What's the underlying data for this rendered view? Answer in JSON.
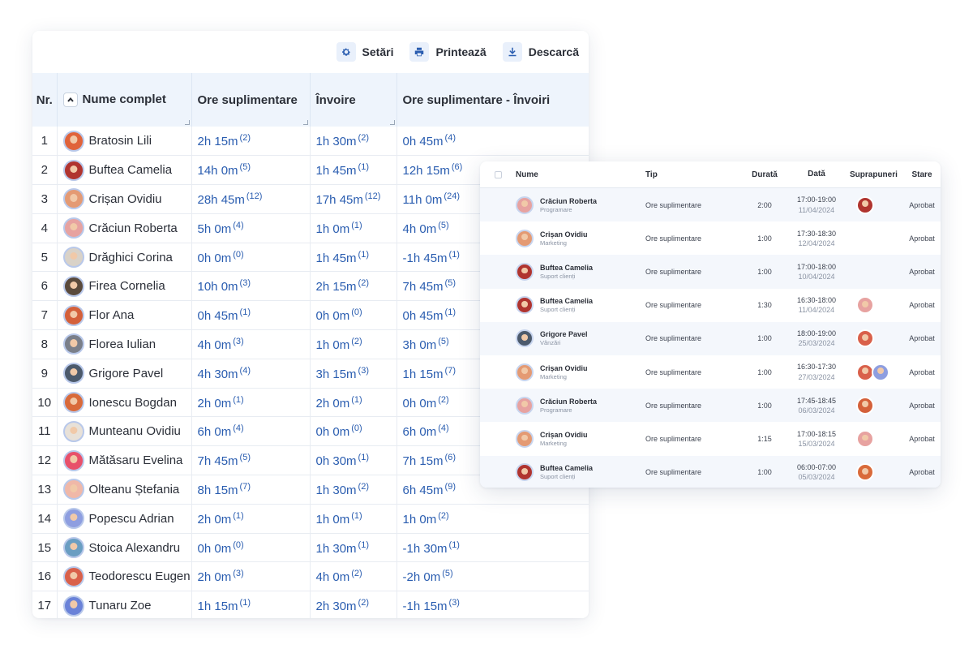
{
  "toolbar": {
    "settings_label": "Setări",
    "print_label": "Printează",
    "download_label": "Descarcă",
    "accent_color": "#2a5db0"
  },
  "main_table": {
    "headers": {
      "nr": "Nr.",
      "name": "Nume complet",
      "overtime": "Ore suplimentare",
      "leave": "Învoire",
      "diff": "Ore suplimentare - Învoiri"
    },
    "rows": [
      {
        "nr": "1",
        "name": "Bratosin Lili",
        "ov": "2h 15m",
        "ov_c": "(2)",
        "lv": "1h 30m",
        "lv_c": "(2)",
        "df": "0h 45m",
        "df_c": "(4)",
        "avatar_color": "#e0633a"
      },
      {
        "nr": "2",
        "name": "Buftea Camelia",
        "ov": "14h 0m",
        "ov_c": "(5)",
        "lv": "1h 45m",
        "lv_c": "(1)",
        "df": "12h 15m",
        "df_c": "(6)",
        "avatar_color": "#b0342f"
      },
      {
        "nr": "3",
        "name": "Crișan Ovidiu",
        "ov": "28h 45m",
        "ov_c": "(12)",
        "lv": "17h 45m",
        "lv_c": "(12)",
        "df": "11h 0m",
        "df_c": "(24)",
        "avatar_color": "#e49a73"
      },
      {
        "nr": "4",
        "name": "Crăciun Roberta",
        "ov": "5h 0m",
        "ov_c": "(4)",
        "lv": "1h 0m",
        "lv_c": "(1)",
        "df": "4h 0m",
        "df_c": "(5)",
        "avatar_color": "#e7a2a0"
      },
      {
        "nr": "5",
        "name": "Drăghici Corina",
        "ov": "0h 0m",
        "ov_c": "(0)",
        "lv": "1h 45m",
        "lv_c": "(1)",
        "df": "-1h 45m",
        "df_c": "(1)",
        "avatar_color": "#d9d2c8"
      },
      {
        "nr": "6",
        "name": "Firea Cornelia",
        "ov": "10h 0m",
        "ov_c": "(3)",
        "lv": "2h 15m",
        "lv_c": "(2)",
        "df": "7h 45m",
        "df_c": "(5)",
        "avatar_color": "#5a4a3c"
      },
      {
        "nr": "7",
        "name": "Flor Ana",
        "ov": "0h 45m",
        "ov_c": "(1)",
        "lv": "0h 0m",
        "lv_c": "(0)",
        "df": "0h 45m",
        "df_c": "(1)",
        "avatar_color": "#d4603a"
      },
      {
        "nr": "8",
        "name": "Florea Iulian",
        "ov": "4h 0m",
        "ov_c": "(3)",
        "lv": "1h 0m",
        "lv_c": "(2)",
        "df": "3h 0m",
        "df_c": "(5)",
        "avatar_color": "#7a7f8a"
      },
      {
        "nr": "9",
        "name": "Grigore Pavel",
        "ov": "4h 30m",
        "ov_c": "(4)",
        "lv": "3h 15m",
        "lv_c": "(3)",
        "df": "1h 15m",
        "df_c": "(7)",
        "avatar_color": "#4c5a6c"
      },
      {
        "nr": "10",
        "name": "Ionescu Bogdan",
        "ov": "2h 0m",
        "ov_c": "(1)",
        "lv": "2h 0m",
        "lv_c": "(1)",
        "df": "0h 0m",
        "df_c": "(2)",
        "avatar_color": "#d96a3a"
      },
      {
        "nr": "11",
        "name": "Munteanu Ovidiu",
        "ov": "6h 0m",
        "ov_c": "(4)",
        "lv": "0h 0m",
        "lv_c": "(0)",
        "df": "6h 0m",
        "df_c": "(4)",
        "avatar_color": "#e8e1d8"
      },
      {
        "nr": "12",
        "name": "Mătăsaru Evelina",
        "ov": "7h 45m",
        "ov_c": "(5)",
        "lv": "0h 30m",
        "lv_c": "(1)",
        "df": "7h 15m",
        "df_c": "(6)",
        "avatar_color": "#e8506a"
      },
      {
        "nr": "13",
        "name": "Olteanu Ștefania",
        "ov": "8h 15m",
        "ov_c": "(7)",
        "lv": "1h 30m",
        "lv_c": "(2)",
        "df": "6h 45m",
        "df_c": "(9)",
        "avatar_color": "#f0b8a8"
      },
      {
        "nr": "14",
        "name": "Popescu Adrian",
        "ov": "2h 0m",
        "ov_c": "(1)",
        "lv": "1h 0m",
        "lv_c": "(1)",
        "df": "1h 0m",
        "df_c": "(2)",
        "avatar_color": "#8e9ee0"
      },
      {
        "nr": "15",
        "name": "Stoica Alexandru",
        "ov": "0h 0m",
        "ov_c": "(0)",
        "lv": "1h 30m",
        "lv_c": "(1)",
        "df": "-1h 30m",
        "df_c": "(1)",
        "avatar_color": "#6a9ec2"
      },
      {
        "nr": "16",
        "name": "Teodorescu Eugen",
        "ov": "2h 0m",
        "ov_c": "(3)",
        "lv": "4h 0m",
        "lv_c": "(2)",
        "df": "-2h 0m",
        "df_c": "(5)",
        "avatar_color": "#d9604a"
      },
      {
        "nr": "17",
        "name": "Tunaru Zoe",
        "ov": "1h 15m",
        "ov_c": "(1)",
        "lv": "2h 30m",
        "lv_c": "(2)",
        "df": "-1h 15m",
        "df_c": "(3)",
        "avatar_color": "#6a82d8"
      }
    ]
  },
  "requests_table": {
    "headers": {
      "name": "Nume",
      "type": "Tip",
      "duration": "Durată",
      "date": "Dată",
      "overlaps": "Suprapuneri",
      "status": "Stare"
    },
    "rows": [
      {
        "name": "Crăciun Roberta",
        "dept": "Programare",
        "type": "Ore suplimentare",
        "dur": "2:00",
        "time": "17:00-19:00",
        "date": "11/04/2024",
        "status": "Aprobat",
        "avatar_color": "#e7a2a0",
        "overlaps": [
          "#b0342f"
        ]
      },
      {
        "name": "Crișan Ovidiu",
        "dept": "Marketing",
        "type": "Ore suplimentare",
        "dur": "1:00",
        "time": "17:30-18:30",
        "date": "12/04/2024",
        "status": "Aprobat",
        "avatar_color": "#e49a73",
        "overlaps": []
      },
      {
        "name": "Buftea Camelia",
        "dept": "Suport clienți",
        "type": "Ore suplimentare",
        "dur": "1:00",
        "time": "17:00-18:00",
        "date": "10/04/2024",
        "status": "Aprobat",
        "avatar_color": "#b0342f",
        "overlaps": []
      },
      {
        "name": "Buftea Camelia",
        "dept": "Suport clienți",
        "type": "Ore suplimentare",
        "dur": "1:30",
        "time": "16:30-18:00",
        "date": "11/04/2024",
        "status": "Aprobat",
        "avatar_color": "#b0342f",
        "overlaps": [
          "#e7a2a0"
        ]
      },
      {
        "name": "Grigore Pavel",
        "dept": "Vânzări",
        "type": "Ore suplimentare",
        "dur": "1:00",
        "time": "18:00-19:00",
        "date": "25/03/2024",
        "status": "Aprobat",
        "avatar_color": "#4c5a6c",
        "overlaps": [
          "#d9604a"
        ]
      },
      {
        "name": "Crișan Ovidiu",
        "dept": "Marketing",
        "type": "Ore suplimentare",
        "dur": "1:00",
        "time": "16:30-17:30",
        "date": "27/03/2024",
        "status": "Aprobat",
        "avatar_color": "#e49a73",
        "overlaps": [
          "#d9604a",
          "#8e9ee0"
        ]
      },
      {
        "name": "Crăciun Roberta",
        "dept": "Programare",
        "type": "Ore suplimentare",
        "dur": "1:00",
        "time": "17:45-18:45",
        "date": "06/03/2024",
        "status": "Aprobat",
        "avatar_color": "#e7a2a0",
        "overlaps": [
          "#d4603a"
        ]
      },
      {
        "name": "Crișan Ovidiu",
        "dept": "Marketing",
        "type": "Ore suplimentare",
        "dur": "1:15",
        "time": "17:00-18:15",
        "date": "15/03/2024",
        "status": "Aprobat",
        "avatar_color": "#e49a73",
        "overlaps": [
          "#e7a2a0"
        ]
      },
      {
        "name": "Buftea Camelia",
        "dept": "Suport clienți",
        "type": "Ore suplimentare",
        "dur": "1:00",
        "time": "06:00-07:00",
        "date": "05/03/2024",
        "status": "Aprobat",
        "avatar_color": "#b0342f",
        "overlaps": [
          "#d96a3a"
        ]
      }
    ]
  }
}
